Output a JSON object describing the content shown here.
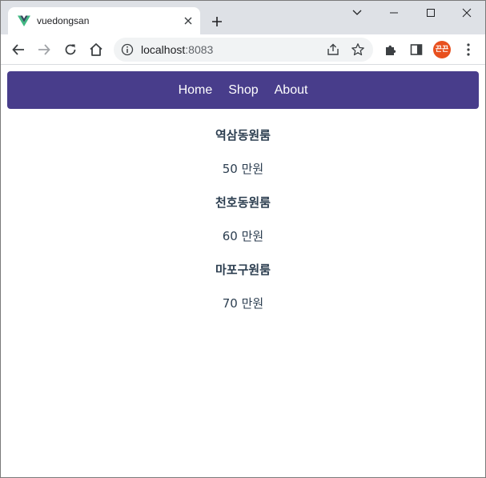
{
  "browser": {
    "tab": {
      "title": "vuedongsan",
      "favicon": "vue-logo-icon",
      "close_icon": "close-icon"
    },
    "new_tab_icon": "plus-icon",
    "window_controls": [
      "chevron-down-icon",
      "minimize-icon",
      "maximize-icon",
      "close-icon"
    ],
    "address_bar": {
      "host": "localhost",
      "port": ":8083"
    },
    "profile_badge": "끈끈"
  },
  "nav": {
    "links": [
      "Home",
      "Shop",
      "About"
    ]
  },
  "products": [
    {
      "name": "역삼동원룸",
      "price": "50 만원"
    },
    {
      "name": "천호동원룸",
      "price": "60 만원"
    },
    {
      "name": "마포구원룸",
      "price": "70 만원"
    }
  ],
  "colors": {
    "nav_background": "#483d8b",
    "nav_text": "#ffffff",
    "text": "#2c3e50",
    "tabstrip": "#dee1e6",
    "avatar": "#e8501e"
  }
}
